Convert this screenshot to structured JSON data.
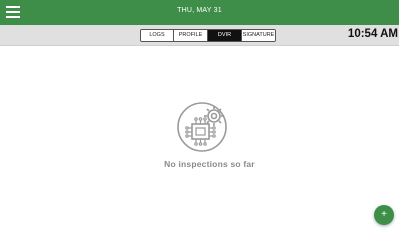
{
  "header": {
    "date": "THU, MAY 31"
  },
  "tabs": [
    {
      "label": "LOGS",
      "active": false
    },
    {
      "label": "PROFILE",
      "active": false
    },
    {
      "label": "DVIR",
      "active": true
    },
    {
      "label": "SIGNATURE",
      "active": false
    }
  ],
  "clock": "10:54 AM",
  "empty_state": {
    "message": "No inspections so far",
    "icon": "chip-gear-icon"
  },
  "fab": {
    "label": "+",
    "icon": "add-icon"
  },
  "colors": {
    "primary": "#3e8e4a",
    "subbar": "#e0e0e0",
    "active_tab": "#111111",
    "muted_text": "#8a8a8a"
  }
}
